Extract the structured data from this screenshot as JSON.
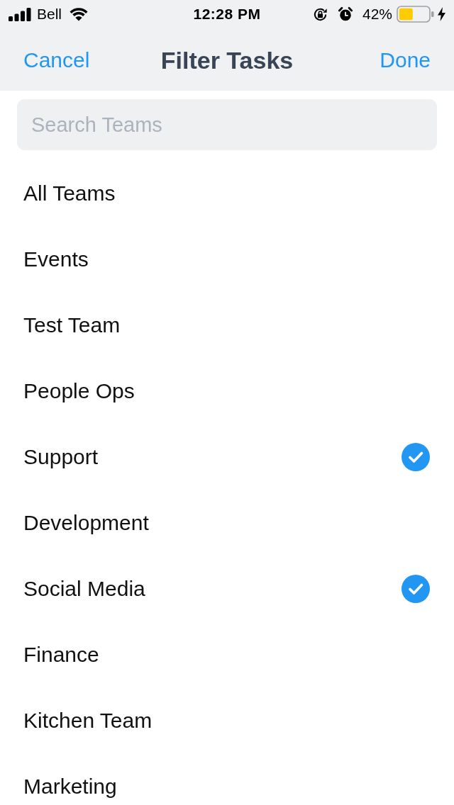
{
  "status_bar": {
    "carrier": "Bell",
    "time": "12:28 PM",
    "battery": "42%"
  },
  "nav_bar": {
    "cancel": "Cancel",
    "title": "Filter Tasks",
    "done": "Done"
  },
  "search": {
    "placeholder": "Search Teams"
  },
  "teams": [
    {
      "name": "All Teams",
      "selected": false
    },
    {
      "name": "Events",
      "selected": false
    },
    {
      "name": "Test Team",
      "selected": false
    },
    {
      "name": "People Ops",
      "selected": false
    },
    {
      "name": "Support",
      "selected": true
    },
    {
      "name": "Development",
      "selected": false
    },
    {
      "name": "Social Media",
      "selected": true
    },
    {
      "name": "Finance",
      "selected": false
    },
    {
      "name": "Kitchen Team",
      "selected": false
    },
    {
      "name": "Marketing",
      "selected": false
    }
  ]
}
